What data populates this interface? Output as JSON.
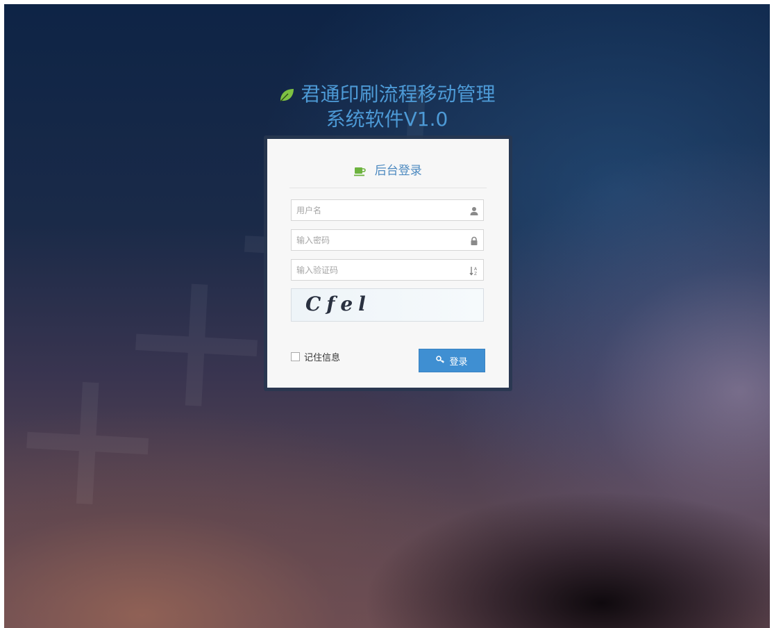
{
  "app": {
    "title_line1": "君通印刷流程移动管理",
    "title_line2": "系统软件V1.0"
  },
  "login": {
    "heading": "后台登录",
    "username_placeholder": "用户名",
    "password_placeholder": "输入密码",
    "captcha_placeholder": "输入验证码",
    "captcha_text": "Cfel",
    "remember_label": "记住信息",
    "submit_label": "登录"
  },
  "icons": {
    "title": "leaf-icon",
    "heading": "coffee-cup-icon",
    "username": "user-icon",
    "password": "lock-icon",
    "captcha": "sort-alpha-icon",
    "submit": "key-icon"
  },
  "colors": {
    "accent": "#4d9ad6",
    "leaf": "#7ec142",
    "button": "#3f8fd2"
  }
}
